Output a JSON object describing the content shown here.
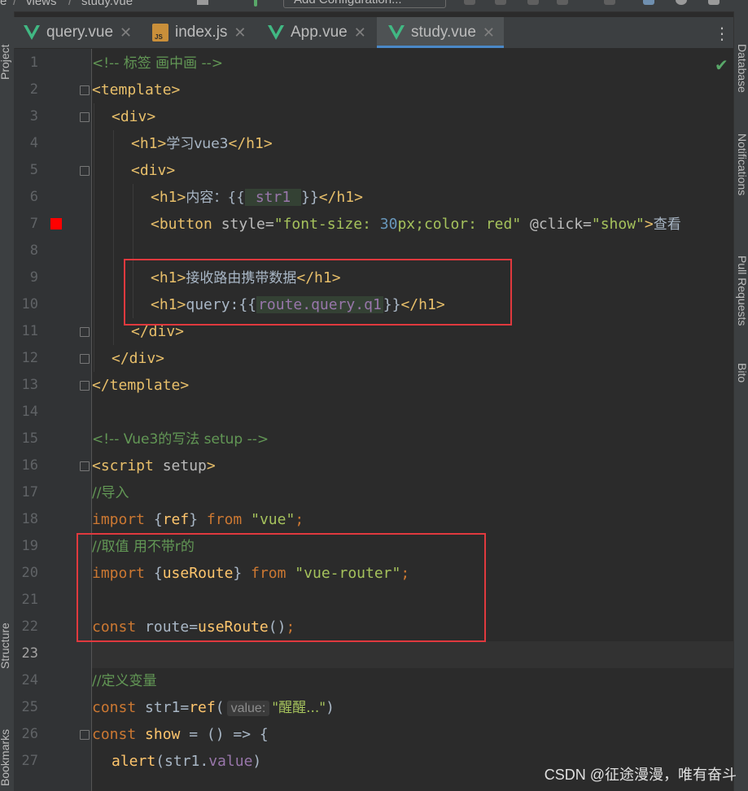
{
  "nav": {
    "crumb1": "e",
    "crumb2": "views",
    "crumb3": "study.vue",
    "config": "Add Configuration..."
  },
  "tabs": [
    {
      "label": "query.vue",
      "icon": "vue-icon"
    },
    {
      "label": "index.js",
      "icon": "js-icon"
    },
    {
      "label": "App.vue",
      "icon": "vue-icon"
    },
    {
      "label": "study.vue",
      "icon": "vue-icon",
      "active": true
    }
  ],
  "side": {
    "project": "Project",
    "structure": "Structure",
    "bookmarks": "Bookmarks",
    "database": "Database",
    "notifications": "Notifications",
    "pull_requests": "Pull Requests",
    "bito": "Bito"
  },
  "line_numbers": [
    "1",
    "2",
    "3",
    "4",
    "5",
    "6",
    "7",
    "8",
    "9",
    "10",
    "11",
    "12",
    "13",
    "14",
    "15",
    "16",
    "17",
    "18",
    "19",
    "20",
    "21",
    "22",
    "23",
    "24",
    "25",
    "26",
    "27"
  ],
  "current_line": "23",
  "code": {
    "l1": "<!-- 标签 画中画 -->",
    "l2_tag": "<template>",
    "l3_tag": "<div>",
    "l4_open": "<h1>",
    "l4_text": "学习vue3",
    "l4_close": "</h1>",
    "l5_tag": "<div>",
    "l6_open": "<h1>",
    "l6_text": "内容：{{",
    "l6_var": " str1 ",
    "l6_end": "}}",
    "l6_close": "</h1>",
    "l7_open": "<button",
    "l7_attr1": " style=",
    "l7_s1": "\"font-size: ",
    "l7_num": "30",
    "l7_s2": "px;color: red\"",
    "l7_attr2": " @click=",
    "l7_s3": "\"show\"",
    "l7_gt": ">",
    "l7_text": "查看",
    "l9_open": "<h1>",
    "l9_text": "接收路由携带数据",
    "l9_close": "</h1>",
    "l10_open": "<h1>",
    "l10_text": "query:{{",
    "l10_var": "route.query.q1",
    "l10_end": "}}",
    "l10_close": "</h1>",
    "l11_tag": "</div>",
    "l12_tag": "</div>",
    "l13_tag": "</template>",
    "l15": "<!-- Vue3的写法 setup -->",
    "l16_open": "<script",
    "l16_attr": " setup",
    "l16_gt": ">",
    "l17": "//导入",
    "l18_kw": "import",
    "l18_a": " {",
    "l18_fn": "ref",
    "l18_b": "} ",
    "l18_from": "from",
    "l18_str": " \"vue\"",
    "l18_semi": ";",
    "l19": "//取值 用不带r的",
    "l20_kw": "import",
    "l20_a": " {",
    "l20_fn": "useRoute",
    "l20_b": "} ",
    "l20_from": "from",
    "l20_str": " \"vue-router\"",
    "l20_semi": ";",
    "l22_kw": "const",
    "l22_a": " route=",
    "l22_fn": "useRoute",
    "l22_b": "()",
    "l22_semi": ";",
    "l24": "//定义变量",
    "l25_kw": "const",
    "l25_a": " str1=",
    "l25_fn": "ref",
    "l25_b": "(",
    "l25_hint": "value:",
    "l25_str": "\"醒醒...\"",
    "l25_c": ")",
    "l26_kw": "const",
    "l26_fn": " show",
    "l26_a": " = () => {",
    "l27_fn": "alert",
    "l27_a": "(str1.",
    "l27_prop": "value",
    "l27_b": ")"
  },
  "watermark": "CSDN @征途漫漫，唯有奋斗",
  "colors": {
    "breakpoint": "#ff0000",
    "highlight_box": "#e0393e",
    "vue_green": "#41b883"
  }
}
